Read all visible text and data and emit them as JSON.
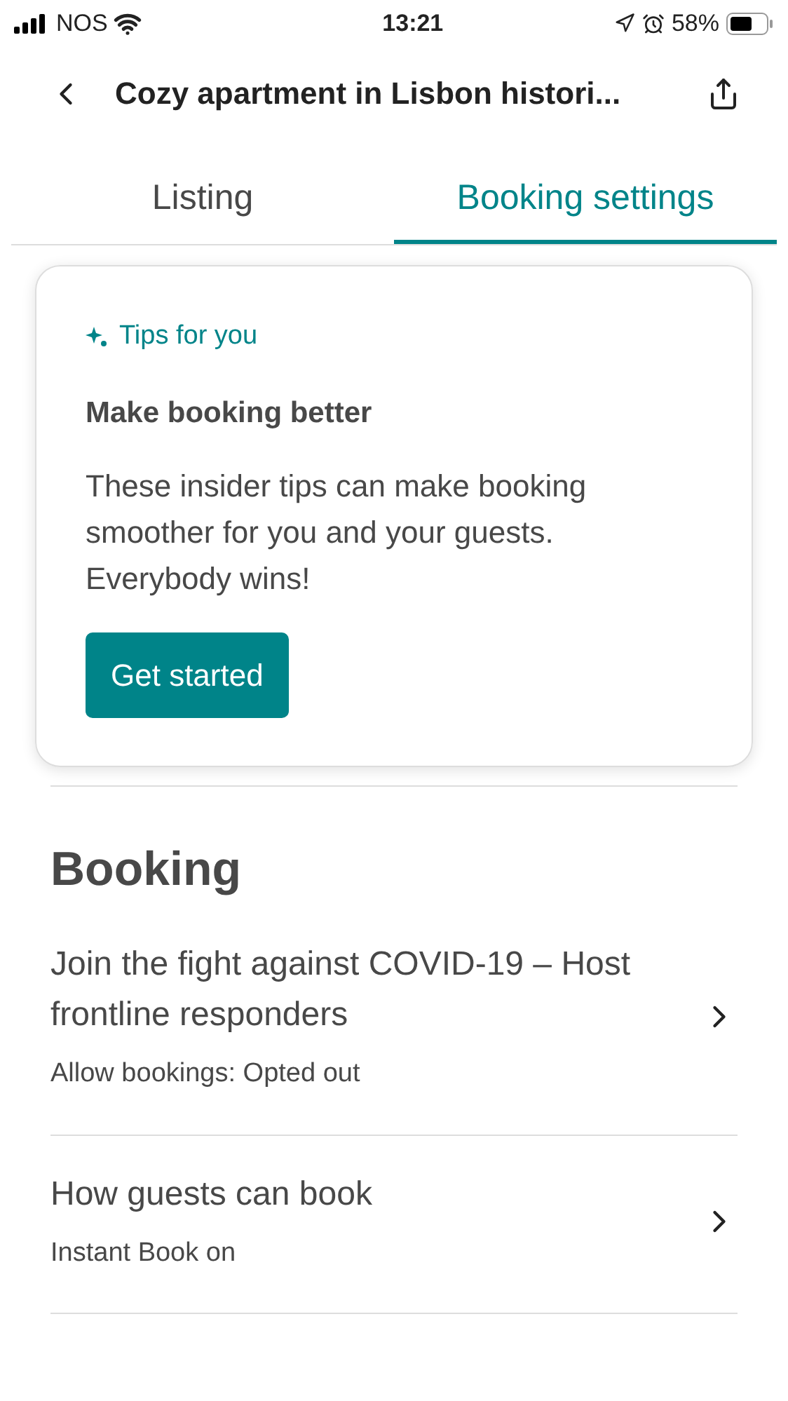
{
  "status_bar": {
    "carrier": "NOS",
    "time": "13:21",
    "battery": "58%"
  },
  "header": {
    "title": "Cozy apartment in Lisbon histori..."
  },
  "tabs": [
    {
      "label": "Listing",
      "selected": false
    },
    {
      "label": "Booking settings",
      "selected": true
    }
  ],
  "tips_card": {
    "eyebrow": "Tips for you",
    "title": "Make booking better",
    "body": "These insider tips can make booking smoother for you and your guests. Everybody wins!",
    "button": "Get started"
  },
  "section": {
    "title": "Booking"
  },
  "rows": [
    {
      "title": "Join the fight against COVID-19 – Host frontline responders",
      "subtitle": "Allow bookings: Opted out"
    },
    {
      "title": "How guests can book",
      "subtitle": "Instant Book on"
    }
  ]
}
